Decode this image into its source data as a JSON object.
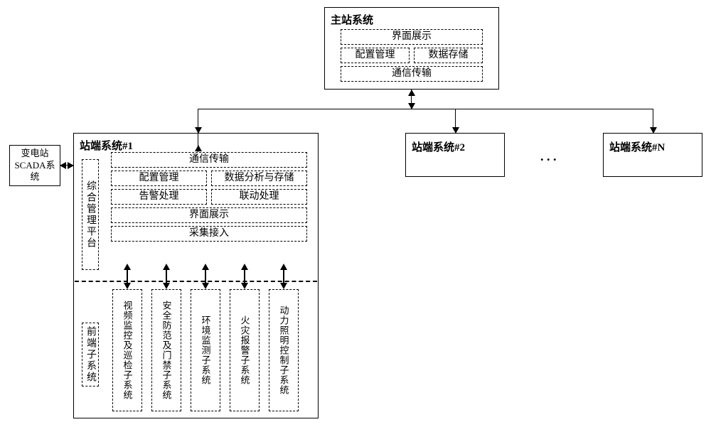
{
  "master": {
    "title": "主站系统",
    "ui_display": "界面展示",
    "config_mgmt": "配置管理",
    "data_storage": "数据存储",
    "comm_transport": "通信传输"
  },
  "scada": "变电站\nSCADA系统",
  "station1": {
    "title": "站端系统#1",
    "platform_label": "综合管理平台",
    "comm_transport": "通信传输",
    "config_mgmt": "配置管理",
    "data_analysis_storage": "数据分析与存储",
    "alarm_handling": "告警处理",
    "linkage_handling": "联动处理",
    "ui_display": "界面展示",
    "collection_access": "采集接入",
    "subsys_label": "前端子系统",
    "subsystems": [
      "视频监控及巡检子系统",
      "安全防范及门禁子系统",
      "环境监测子系统",
      "火灾报警子系统",
      "动力照明控制子系统"
    ]
  },
  "station2": {
    "title": "站端系统#2"
  },
  "stationN": {
    "title": "站端系统#N"
  },
  "dots": ". . ."
}
